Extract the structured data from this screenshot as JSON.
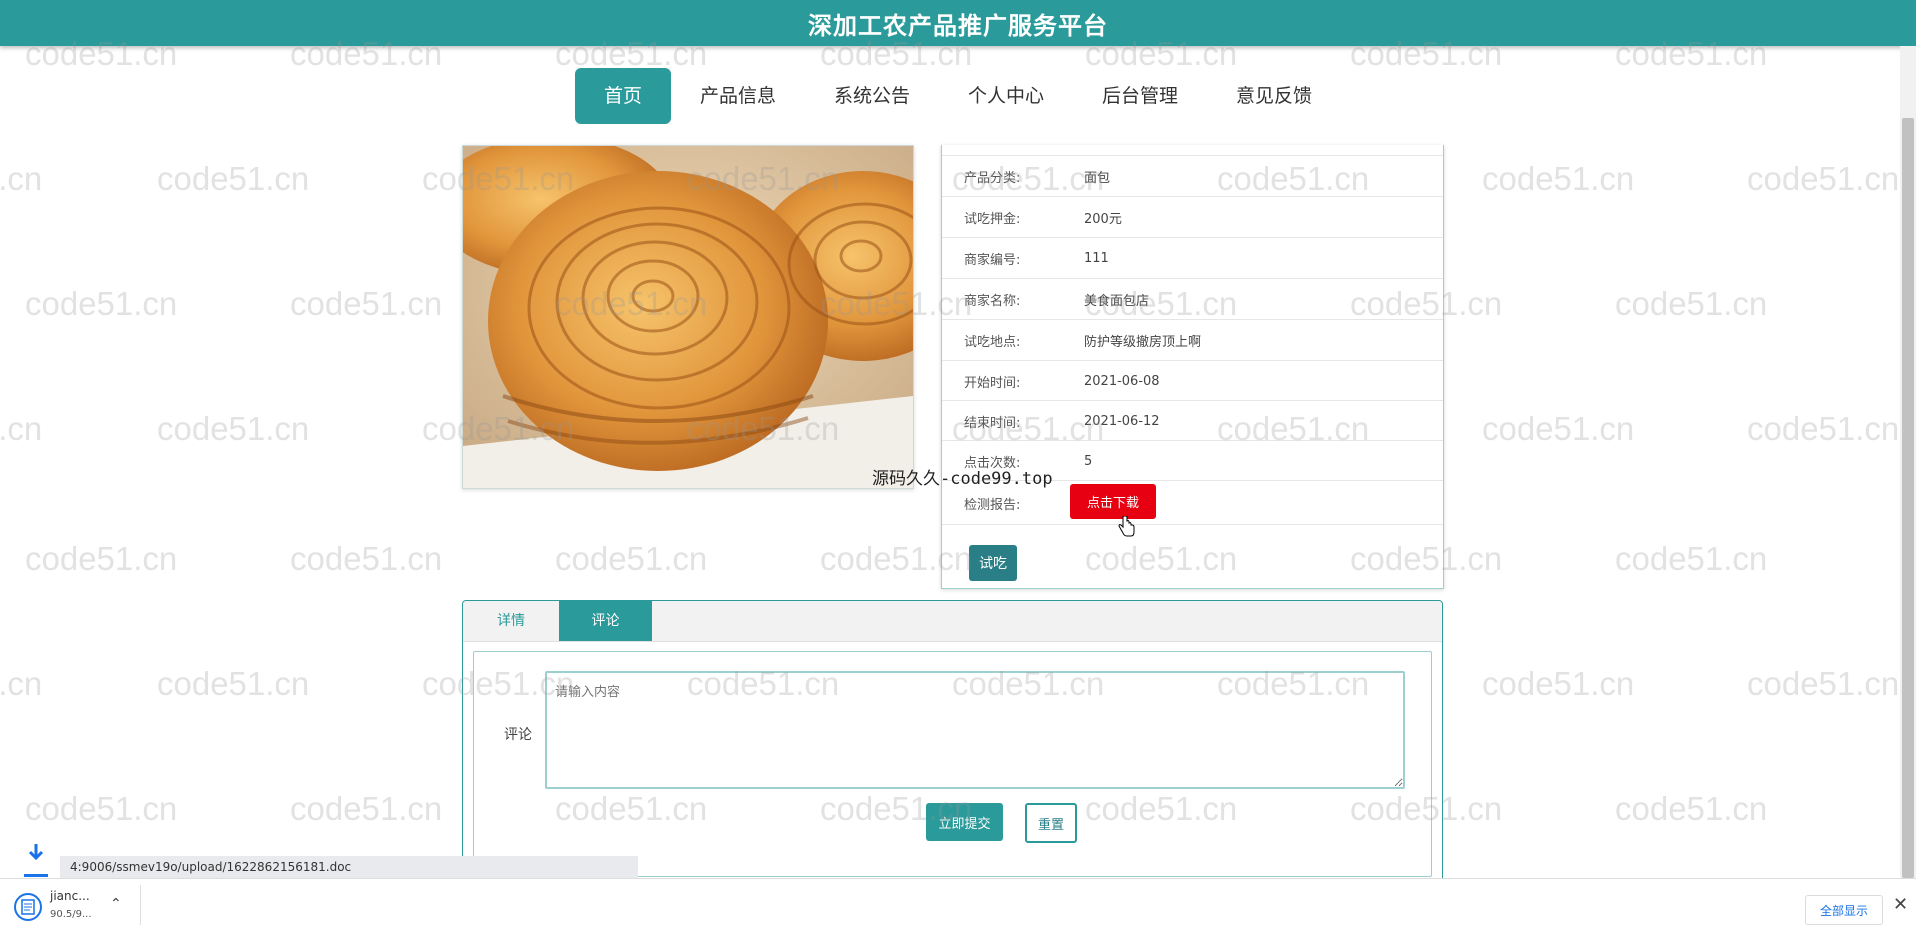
{
  "header": {
    "site_title": "深加工农产品推广服务平台"
  },
  "nav": {
    "items": [
      {
        "label": "首页",
        "active": true
      },
      {
        "label": "产品信息"
      },
      {
        "label": "系统公告"
      },
      {
        "label": "个人中心"
      },
      {
        "label": "后台管理"
      },
      {
        "label": "意见反馈"
      }
    ]
  },
  "product": {
    "image_alt": "bread",
    "fields": [
      {
        "label": "产品分类:",
        "value": "面包"
      },
      {
        "label": "试吃押金:",
        "value": "200元"
      },
      {
        "label": "商家编号:",
        "value": "111"
      },
      {
        "label": "商家名称:",
        "value": "美食面包店"
      },
      {
        "label": "试吃地点:",
        "value": "防护等级撤房顶上啊"
      },
      {
        "label": "开始时间:",
        "value": "2021-06-08"
      },
      {
        "label": "结束时间:",
        "value": "2021-06-12"
      },
      {
        "label": "点击次数:",
        "value": "5"
      }
    ],
    "report_label": "检测报告:",
    "download_label": "点击下载",
    "try_label": "试吃"
  },
  "overlay_text": "源码久久-code99.top",
  "tabs": {
    "detail_label": "详情",
    "comment_label": "评论",
    "comment_field_label": "评论",
    "comment_placeholder": "请输入内容",
    "submit_label": "立即提交",
    "reset_label": "重置"
  },
  "browser": {
    "status_url": "4:9006/ssmev19o/upload/1622862156181.doc",
    "download_name": "jianc...",
    "download_size": "90.5/9...",
    "show_all_label": "全部显示",
    "close_icon": "close-icon"
  },
  "watermark_text": "code51.cn",
  "colors": {
    "primary": "#2a9a9a",
    "download_red": "#e60012"
  }
}
